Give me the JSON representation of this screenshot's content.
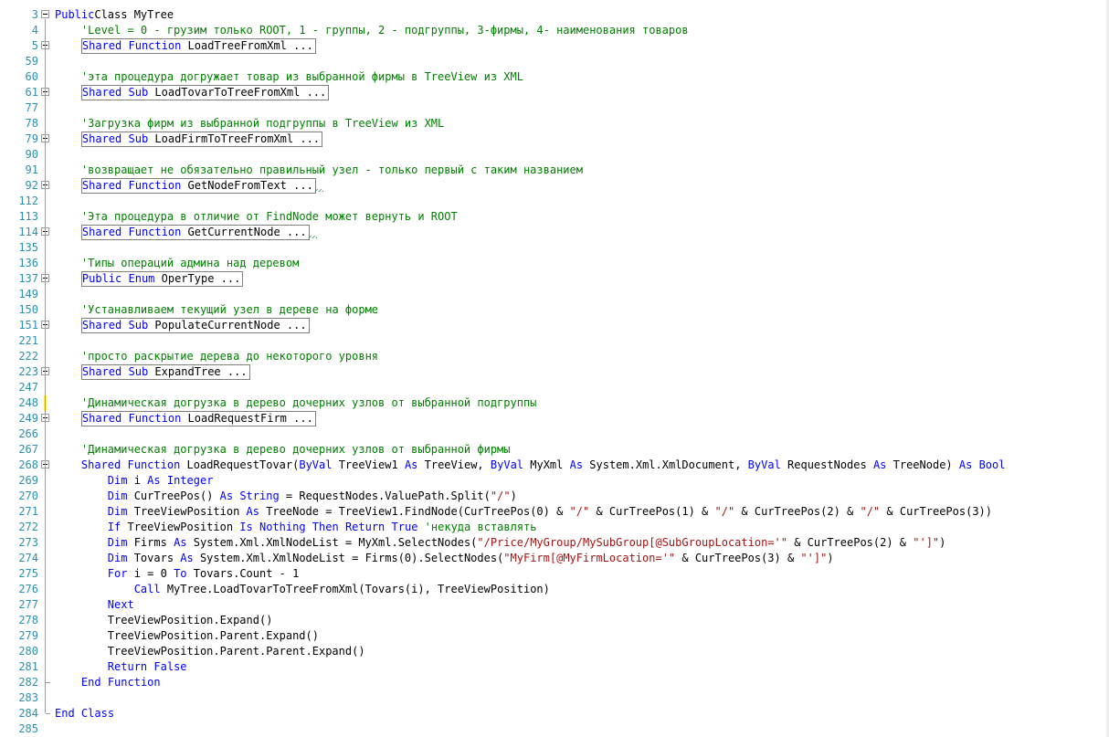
{
  "editor": {
    "lines": [
      {
        "n": "3",
        "fold": "minus",
        "segs": [
          [
            "kw",
            "Public"
          ],
          [
            "",
            "Class MyTree"
          ]
        ]
      },
      {
        "n": "4",
        "fold": "",
        "segs": [
          [
            "",
            "    "
          ],
          [
            "cm",
            "'Level = 0 - грузим только ROOT, 1 - группы, 2 - подгруппы, 3-фирмы, 4- наименования товаров"
          ]
        ]
      },
      {
        "n": "5",
        "fold": "plus",
        "segs": [
          [
            "",
            "    "
          ],
          [
            "box",
            [
              [
                "kw",
                "Shared"
              ],
              [
                "",
                " "
              ],
              [
                "kw",
                "Function"
              ],
              [
                "",
                " LoadTreeFromXml ..."
              ]
            ]
          ]
        ]
      },
      {
        "n": "59",
        "fold": "",
        "segs": []
      },
      {
        "n": "60",
        "fold": "",
        "segs": [
          [
            "",
            "    "
          ],
          [
            "cm",
            "'эта процедура догружает товар из выбранной фирмы в TreeView из XML"
          ]
        ]
      },
      {
        "n": "61",
        "fold": "plus",
        "segs": [
          [
            "",
            "    "
          ],
          [
            "box",
            [
              [
                "kw",
                "Shared"
              ],
              [
                "",
                " "
              ],
              [
                "kw",
                "Sub"
              ],
              [
                "",
                " LoadTovarToTreeFromXml ..."
              ]
            ]
          ]
        ]
      },
      {
        "n": "77",
        "fold": "",
        "segs": []
      },
      {
        "n": "78",
        "fold": "",
        "segs": [
          [
            "",
            "    "
          ],
          [
            "cm",
            "'Загрузка фирм из выбранной подгруппы в TreeView из XML"
          ]
        ]
      },
      {
        "n": "79",
        "fold": "plus",
        "segs": [
          [
            "",
            "    "
          ],
          [
            "box",
            [
              [
                "kw",
                "Shared"
              ],
              [
                "",
                " "
              ],
              [
                "kw",
                "Sub"
              ],
              [
                "",
                " LoadFirmToTreeFromXml ..."
              ]
            ]
          ]
        ]
      },
      {
        "n": "90",
        "fold": "",
        "segs": []
      },
      {
        "n": "91",
        "fold": "",
        "segs": [
          [
            "",
            "    "
          ],
          [
            "cm",
            "'возвращает не обязательно правильный узел - только первый с таким названием"
          ]
        ]
      },
      {
        "n": "92",
        "fold": "plus",
        "squig": true,
        "segs": [
          [
            "",
            "    "
          ],
          [
            "box",
            [
              [
                "kw",
                "Shared"
              ],
              [
                "",
                " "
              ],
              [
                "kw",
                "Function"
              ],
              [
                "",
                " GetNodeFromText ..."
              ]
            ]
          ]
        ]
      },
      {
        "n": "112",
        "fold": "",
        "segs": []
      },
      {
        "n": "113",
        "fold": "",
        "segs": [
          [
            "",
            "    "
          ],
          [
            "cm",
            "'Эта процедура в отличие от FindNode может вернуть и ROOT"
          ]
        ]
      },
      {
        "n": "114",
        "fold": "plus",
        "squig": true,
        "segs": [
          [
            "",
            "    "
          ],
          [
            "box",
            [
              [
                "kw",
                "Shared"
              ],
              [
                "",
                " "
              ],
              [
                "kw",
                "Function"
              ],
              [
                "",
                " GetCurrentNode ..."
              ]
            ]
          ]
        ]
      },
      {
        "n": "135",
        "fold": "",
        "segs": []
      },
      {
        "n": "136",
        "fold": "",
        "segs": [
          [
            "",
            "    "
          ],
          [
            "cm",
            "'Типы операций админа над деревом"
          ]
        ]
      },
      {
        "n": "137",
        "fold": "plus",
        "segs": [
          [
            "",
            "    "
          ],
          [
            "box",
            [
              [
                "kw",
                "Public"
              ],
              [
                "",
                " "
              ],
              [
                "kw",
                "Enum"
              ],
              [
                "",
                " OperType ..."
              ]
            ]
          ]
        ]
      },
      {
        "n": "149",
        "fold": "",
        "segs": []
      },
      {
        "n": "150",
        "fold": "",
        "segs": [
          [
            "",
            "    "
          ],
          [
            "cm",
            "'Устанавливаем текущий узел в дереве на форме"
          ]
        ]
      },
      {
        "n": "151",
        "fold": "plus",
        "segs": [
          [
            "",
            "    "
          ],
          [
            "box",
            [
              [
                "kw",
                "Shared"
              ],
              [
                "",
                " "
              ],
              [
                "kw",
                "Sub"
              ],
              [
                "",
                " PopulateCurrentNode ..."
              ]
            ]
          ]
        ]
      },
      {
        "n": "221",
        "fold": "",
        "segs": []
      },
      {
        "n": "222",
        "fold": "",
        "segs": [
          [
            "",
            "    "
          ],
          [
            "cm",
            "'просто раскрытие дерева до некоторого уровня"
          ]
        ]
      },
      {
        "n": "223",
        "fold": "plus",
        "segs": [
          [
            "",
            "    "
          ],
          [
            "box",
            [
              [
                "kw",
                "Shared"
              ],
              [
                "",
                " "
              ],
              [
                "kw",
                "Sub"
              ],
              [
                "",
                " ExpandTree ..."
              ]
            ]
          ]
        ]
      },
      {
        "n": "247",
        "fold": "",
        "segs": []
      },
      {
        "n": "248",
        "fold": "",
        "mark": true,
        "segs": [
          [
            "",
            "    "
          ],
          [
            "cm",
            "'Динамическая догрузка в дерево дочерних узлов от выбранной подгруппы"
          ]
        ]
      },
      {
        "n": "249",
        "fold": "plus",
        "segs": [
          [
            "",
            "    "
          ],
          [
            "box",
            [
              [
                "kw",
                "Shared"
              ],
              [
                "",
                " "
              ],
              [
                "kw",
                "Function"
              ],
              [
                "",
                " LoadRequestFirm ..."
              ]
            ]
          ]
        ]
      },
      {
        "n": "266",
        "fold": "",
        "segs": []
      },
      {
        "n": "267",
        "fold": "",
        "segs": [
          [
            "",
            "    "
          ],
          [
            "cm",
            "'Динамическая догрузка в дерево дочерних узлов от выбранной фирмы"
          ]
        ]
      },
      {
        "n": "268",
        "fold": "minus",
        "segs": [
          [
            "",
            "    "
          ],
          [
            "kw",
            "Shared"
          ],
          [
            "",
            " "
          ],
          [
            "kw",
            "Function"
          ],
          [
            "",
            " LoadRequestTovar("
          ],
          [
            "kw",
            "ByVal"
          ],
          [
            "",
            " TreeView1 "
          ],
          [
            "kw",
            "As"
          ],
          [
            "",
            " TreeView, "
          ],
          [
            "kw",
            "ByVal"
          ],
          [
            "",
            " MyXml "
          ],
          [
            "kw",
            "As"
          ],
          [
            "",
            " System.Xml.XmlDocument, "
          ],
          [
            "kw",
            "ByVal"
          ],
          [
            "",
            " RequestNodes "
          ],
          [
            "kw",
            "As"
          ],
          [
            "",
            " TreeNode) "
          ],
          [
            "kw",
            "As"
          ],
          [
            "",
            " "
          ],
          [
            "kw",
            "Bool"
          ]
        ]
      },
      {
        "n": "269",
        "fold": "",
        "segs": [
          [
            "",
            "        "
          ],
          [
            "kw",
            "Dim"
          ],
          [
            "",
            " i "
          ],
          [
            "kw",
            "As"
          ],
          [
            "",
            " "
          ],
          [
            "kw",
            "Integer"
          ]
        ]
      },
      {
        "n": "270",
        "fold": "",
        "segs": [
          [
            "",
            "        "
          ],
          [
            "kw",
            "Dim"
          ],
          [
            "",
            " CurTreePos() "
          ],
          [
            "kw",
            "As"
          ],
          [
            "",
            " "
          ],
          [
            "kw",
            "String"
          ],
          [
            "",
            " = RequestNodes.ValuePath.Split("
          ],
          [
            "st",
            "\"/\""
          ],
          [
            "",
            ")"
          ]
        ]
      },
      {
        "n": "271",
        "fold": "",
        "segs": [
          [
            "",
            "        "
          ],
          [
            "kw",
            "Dim"
          ],
          [
            "",
            " TreeViewPosition "
          ],
          [
            "kw",
            "As"
          ],
          [
            "",
            " TreeNode = TreeView1.FindNode(CurTreePos(0) & "
          ],
          [
            "st",
            "\"/\""
          ],
          [
            "",
            " & CurTreePos(1) & "
          ],
          [
            "st",
            "\"/\""
          ],
          [
            "",
            " & CurTreePos(2) & "
          ],
          [
            "st",
            "\"/\""
          ],
          [
            "",
            " & CurTreePos(3))"
          ]
        ]
      },
      {
        "n": "272",
        "fold": "",
        "segs": [
          [
            "",
            "        "
          ],
          [
            "kw",
            "If"
          ],
          [
            "",
            " TreeViewPosition "
          ],
          [
            "kw",
            "Is"
          ],
          [
            "",
            " "
          ],
          [
            "kw",
            "Nothing"
          ],
          [
            "",
            " "
          ],
          [
            "kw",
            "Then"
          ],
          [
            "",
            " "
          ],
          [
            "kw",
            "Return"
          ],
          [
            "",
            " "
          ],
          [
            "kw",
            "True"
          ],
          [
            "",
            " "
          ],
          [
            "cm",
            "'некуда вставлять"
          ]
        ]
      },
      {
        "n": "273",
        "fold": "",
        "segs": [
          [
            "",
            "        "
          ],
          [
            "kw",
            "Dim"
          ],
          [
            "",
            " Firms "
          ],
          [
            "kw",
            "As"
          ],
          [
            "",
            " System.Xml.XmlNodeList = MyXml.SelectNodes("
          ],
          [
            "st",
            "\"/Price/MyGroup/MySubGroup[@SubGroupLocation='\""
          ],
          [
            "",
            " & CurTreePos(2) & "
          ],
          [
            "st",
            "\"']\""
          ],
          [
            "",
            ")"
          ]
        ]
      },
      {
        "n": "274",
        "fold": "",
        "segs": [
          [
            "",
            "        "
          ],
          [
            "kw",
            "Dim"
          ],
          [
            "",
            " Tovars "
          ],
          [
            "kw",
            "As"
          ],
          [
            "",
            " System.Xml.XmlNodeList = Firms(0).SelectNodes("
          ],
          [
            "st",
            "\"MyFirm[@MyFirmLocation='\""
          ],
          [
            "",
            " & CurTreePos(3) & "
          ],
          [
            "st",
            "\"']\""
          ],
          [
            "",
            ")"
          ]
        ]
      },
      {
        "n": "275",
        "fold": "",
        "segs": [
          [
            "",
            "        "
          ],
          [
            "kw",
            "For"
          ],
          [
            "",
            " i = 0 "
          ],
          [
            "kw",
            "To"
          ],
          [
            "",
            " Tovars.Count - 1"
          ]
        ]
      },
      {
        "n": "276",
        "fold": "",
        "segs": [
          [
            "",
            "            "
          ],
          [
            "kw",
            "Call"
          ],
          [
            "",
            " MyTree.LoadTovarToTreeFromXml(Tovars(i), TreeViewPosition)"
          ]
        ]
      },
      {
        "n": "277",
        "fold": "",
        "segs": [
          [
            "",
            "        "
          ],
          [
            "kw",
            "Next"
          ]
        ]
      },
      {
        "n": "278",
        "fold": "",
        "segs": [
          [
            "",
            "        TreeViewPosition.Expand()"
          ]
        ]
      },
      {
        "n": "279",
        "fold": "",
        "segs": [
          [
            "",
            "        TreeViewPosition.Parent.Expand()"
          ]
        ]
      },
      {
        "n": "280",
        "fold": "",
        "segs": [
          [
            "",
            "        TreeViewPosition.Parent.Parent.Expand()"
          ]
        ]
      },
      {
        "n": "281",
        "fold": "",
        "segs": [
          [
            "",
            "        "
          ],
          [
            "kw",
            "Return"
          ],
          [
            "",
            " "
          ],
          [
            "kw",
            "False"
          ]
        ]
      },
      {
        "n": "282",
        "fold": "end",
        "segs": [
          [
            "",
            "    "
          ],
          [
            "kw",
            "End"
          ],
          [
            "",
            " "
          ],
          [
            "kw",
            "Function"
          ]
        ]
      },
      {
        "n": "283",
        "fold": "",
        "segs": []
      },
      {
        "n": "284",
        "fold": "end",
        "segs": [
          [
            "kw",
            "End"
          ],
          [
            "",
            " "
          ],
          [
            "kw",
            "Class"
          ]
        ]
      },
      {
        "n": "285",
        "fold": "",
        "segs": []
      }
    ]
  }
}
